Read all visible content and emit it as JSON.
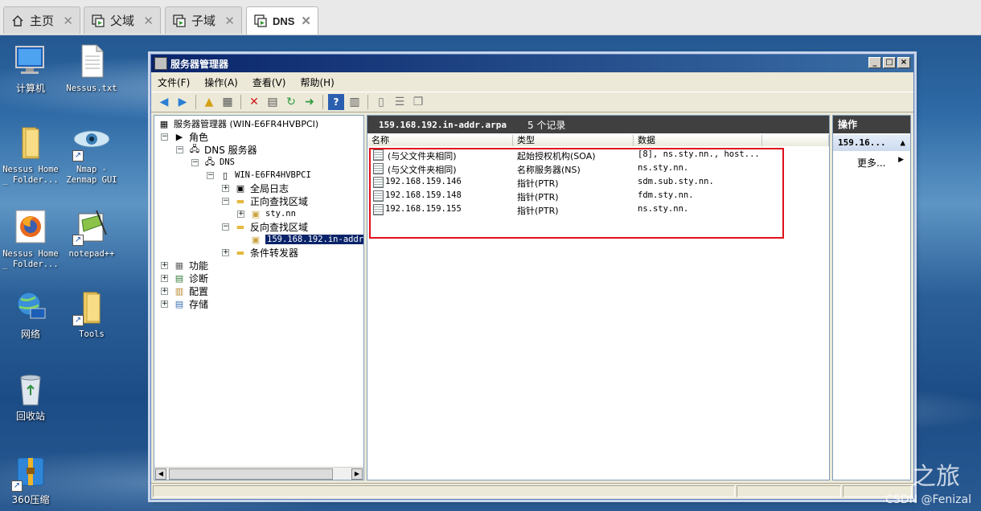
{
  "host_tabs": [
    {
      "label": "主页",
      "icon": "home-icon",
      "active": false
    },
    {
      "label": "父域",
      "icon": "vm-icon",
      "active": false
    },
    {
      "label": "子域",
      "icon": "vm-icon",
      "active": false
    },
    {
      "label": "DNS",
      "icon": "vm-icon",
      "active": true
    }
  ],
  "desktop_icons": [
    {
      "label": "计算机",
      "icon": "computer-icon"
    },
    {
      "label": "Nessus.txt",
      "icon": "text-file-icon"
    },
    {
      "label": "Nessus Home _ Folder...",
      "icon": "folder-icon"
    },
    {
      "label": "Nmap - Zenmap GUI",
      "icon": "nmap-eye-icon"
    },
    {
      "label": "Nessus Home _ Folder...",
      "icon": "firefox-icon"
    },
    {
      "label": "notepad++",
      "icon": "notepadpp-icon"
    },
    {
      "label": "网络",
      "icon": "network-icon"
    },
    {
      "label": "Tools",
      "icon": "folder-icon"
    },
    {
      "label": "回收站",
      "icon": "recycle-bin-icon"
    },
    {
      "label": "360压缩",
      "icon": "archive-icon"
    }
  ],
  "window": {
    "title": "服务器管理器",
    "menu": [
      "文件(F)",
      "操作(A)",
      "查看(V)",
      "帮助(H)"
    ],
    "buttons": {
      "minimize": "_",
      "maximize": "□",
      "close": "×"
    }
  },
  "tree": {
    "root": "服务器管理器 (WIN-E6FR4HVBPCI)",
    "roles": "角色",
    "dns_server": "DNS 服务器",
    "dns": "DNS",
    "host": "WIN-E6FR4HVBPCI",
    "global_logs": "全局日志",
    "forward_zones": "正向查找区域",
    "forward_zone_1": "sty.nn",
    "reverse_zones": "反向查找区域",
    "reverse_zone_1": "159.168.192.in-addr.",
    "conditional_forwarders": "条件转发器",
    "features": "功能",
    "diagnostics": "诊断",
    "configuration": "配置",
    "storage": "存储"
  },
  "center": {
    "zone_name": "159.168.192.in-addr.arpa",
    "record_count": "5 个记录",
    "columns": [
      "名称",
      "类型",
      "数据"
    ],
    "records": [
      {
        "name": "(与父文件夹相同)",
        "type": "起始授权机构(SOA)",
        "data": "[8], ns.sty.nn., host..."
      },
      {
        "name": "(与父文件夹相同)",
        "type": "名称服务器(NS)",
        "data": "ns.sty.nn."
      },
      {
        "name": "192.168.159.146",
        "type": "指针(PTR)",
        "data": "sdm.sub.sty.nn."
      },
      {
        "name": "192.168.159.148",
        "type": "指针(PTR)",
        "data": "fdm.sty.nn."
      },
      {
        "name": "192.168.159.155",
        "type": "指针(PTR)",
        "data": "ns.sty.nn."
      }
    ]
  },
  "actions": {
    "header": "操作",
    "section": "159.16...",
    "more": "更多..."
  },
  "watermark": {
    "csdn": "CSDN @Fenizal",
    "partial": "之旅"
  },
  "colors": {
    "highlight_box": "#e0101a",
    "selection": "#0a246a",
    "pane_header": "#404040"
  }
}
